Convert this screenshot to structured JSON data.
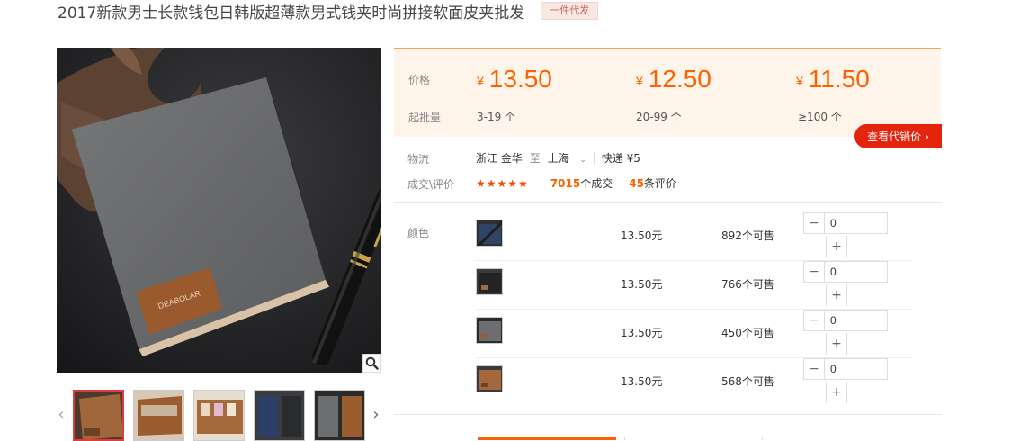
{
  "product": {
    "title": "2017新款男士长款钱包日韩版超薄款男式钱夹时尚拼接软面皮夹批发",
    "badge": "一件代发",
    "brand_on_wallet": "DEABOLAR"
  },
  "pricing": {
    "price_label": "价格",
    "qty_label": "起批量",
    "currency": "¥",
    "tiers": [
      {
        "price": "13.50",
        "range": "3-19 个"
      },
      {
        "price": "12.50",
        "range": "20-99 个"
      },
      {
        "price": "11.50",
        "range": "≥100 个"
      }
    ],
    "agent_button": "查看代销价",
    "agent_arrow": "›"
  },
  "logistics": {
    "label": "物流",
    "from": "浙江 金华",
    "to_word": "至",
    "to": "上海",
    "caret": "⌄",
    "shipping": "快递 ¥5"
  },
  "reviews": {
    "label": "成交\\评价",
    "stars": "★★★★★",
    "deals_count": "7015",
    "deals_text": "个成交",
    "review_count": "45",
    "review_text": "条评价"
  },
  "variants": {
    "label": "颜色",
    "minus": "−",
    "plus": "+",
    "rows": [
      {
        "price": "13.50元",
        "stock": "892个可售",
        "qty": "0",
        "color": "blue"
      },
      {
        "price": "13.50元",
        "stock": "766个可售",
        "qty": "0",
        "color": "black"
      },
      {
        "price": "13.50元",
        "stock": "450个可售",
        "qty": "0",
        "color": "gray"
      },
      {
        "price": "13.50元",
        "stock": "568个可售",
        "qty": "0",
        "color": "brown"
      }
    ]
  },
  "gallery": {
    "prev_icon": "‹",
    "next_icon": "›",
    "zoom_icon": "magnifier-icon",
    "thumbs": [
      "brown-front",
      "brown-open",
      "cards-open",
      "blue-black",
      "gray-brown"
    ]
  },
  "colors": {
    "accent": "#ff6000",
    "red_button": "#e4240d",
    "price_bg": "#fff4ea"
  }
}
